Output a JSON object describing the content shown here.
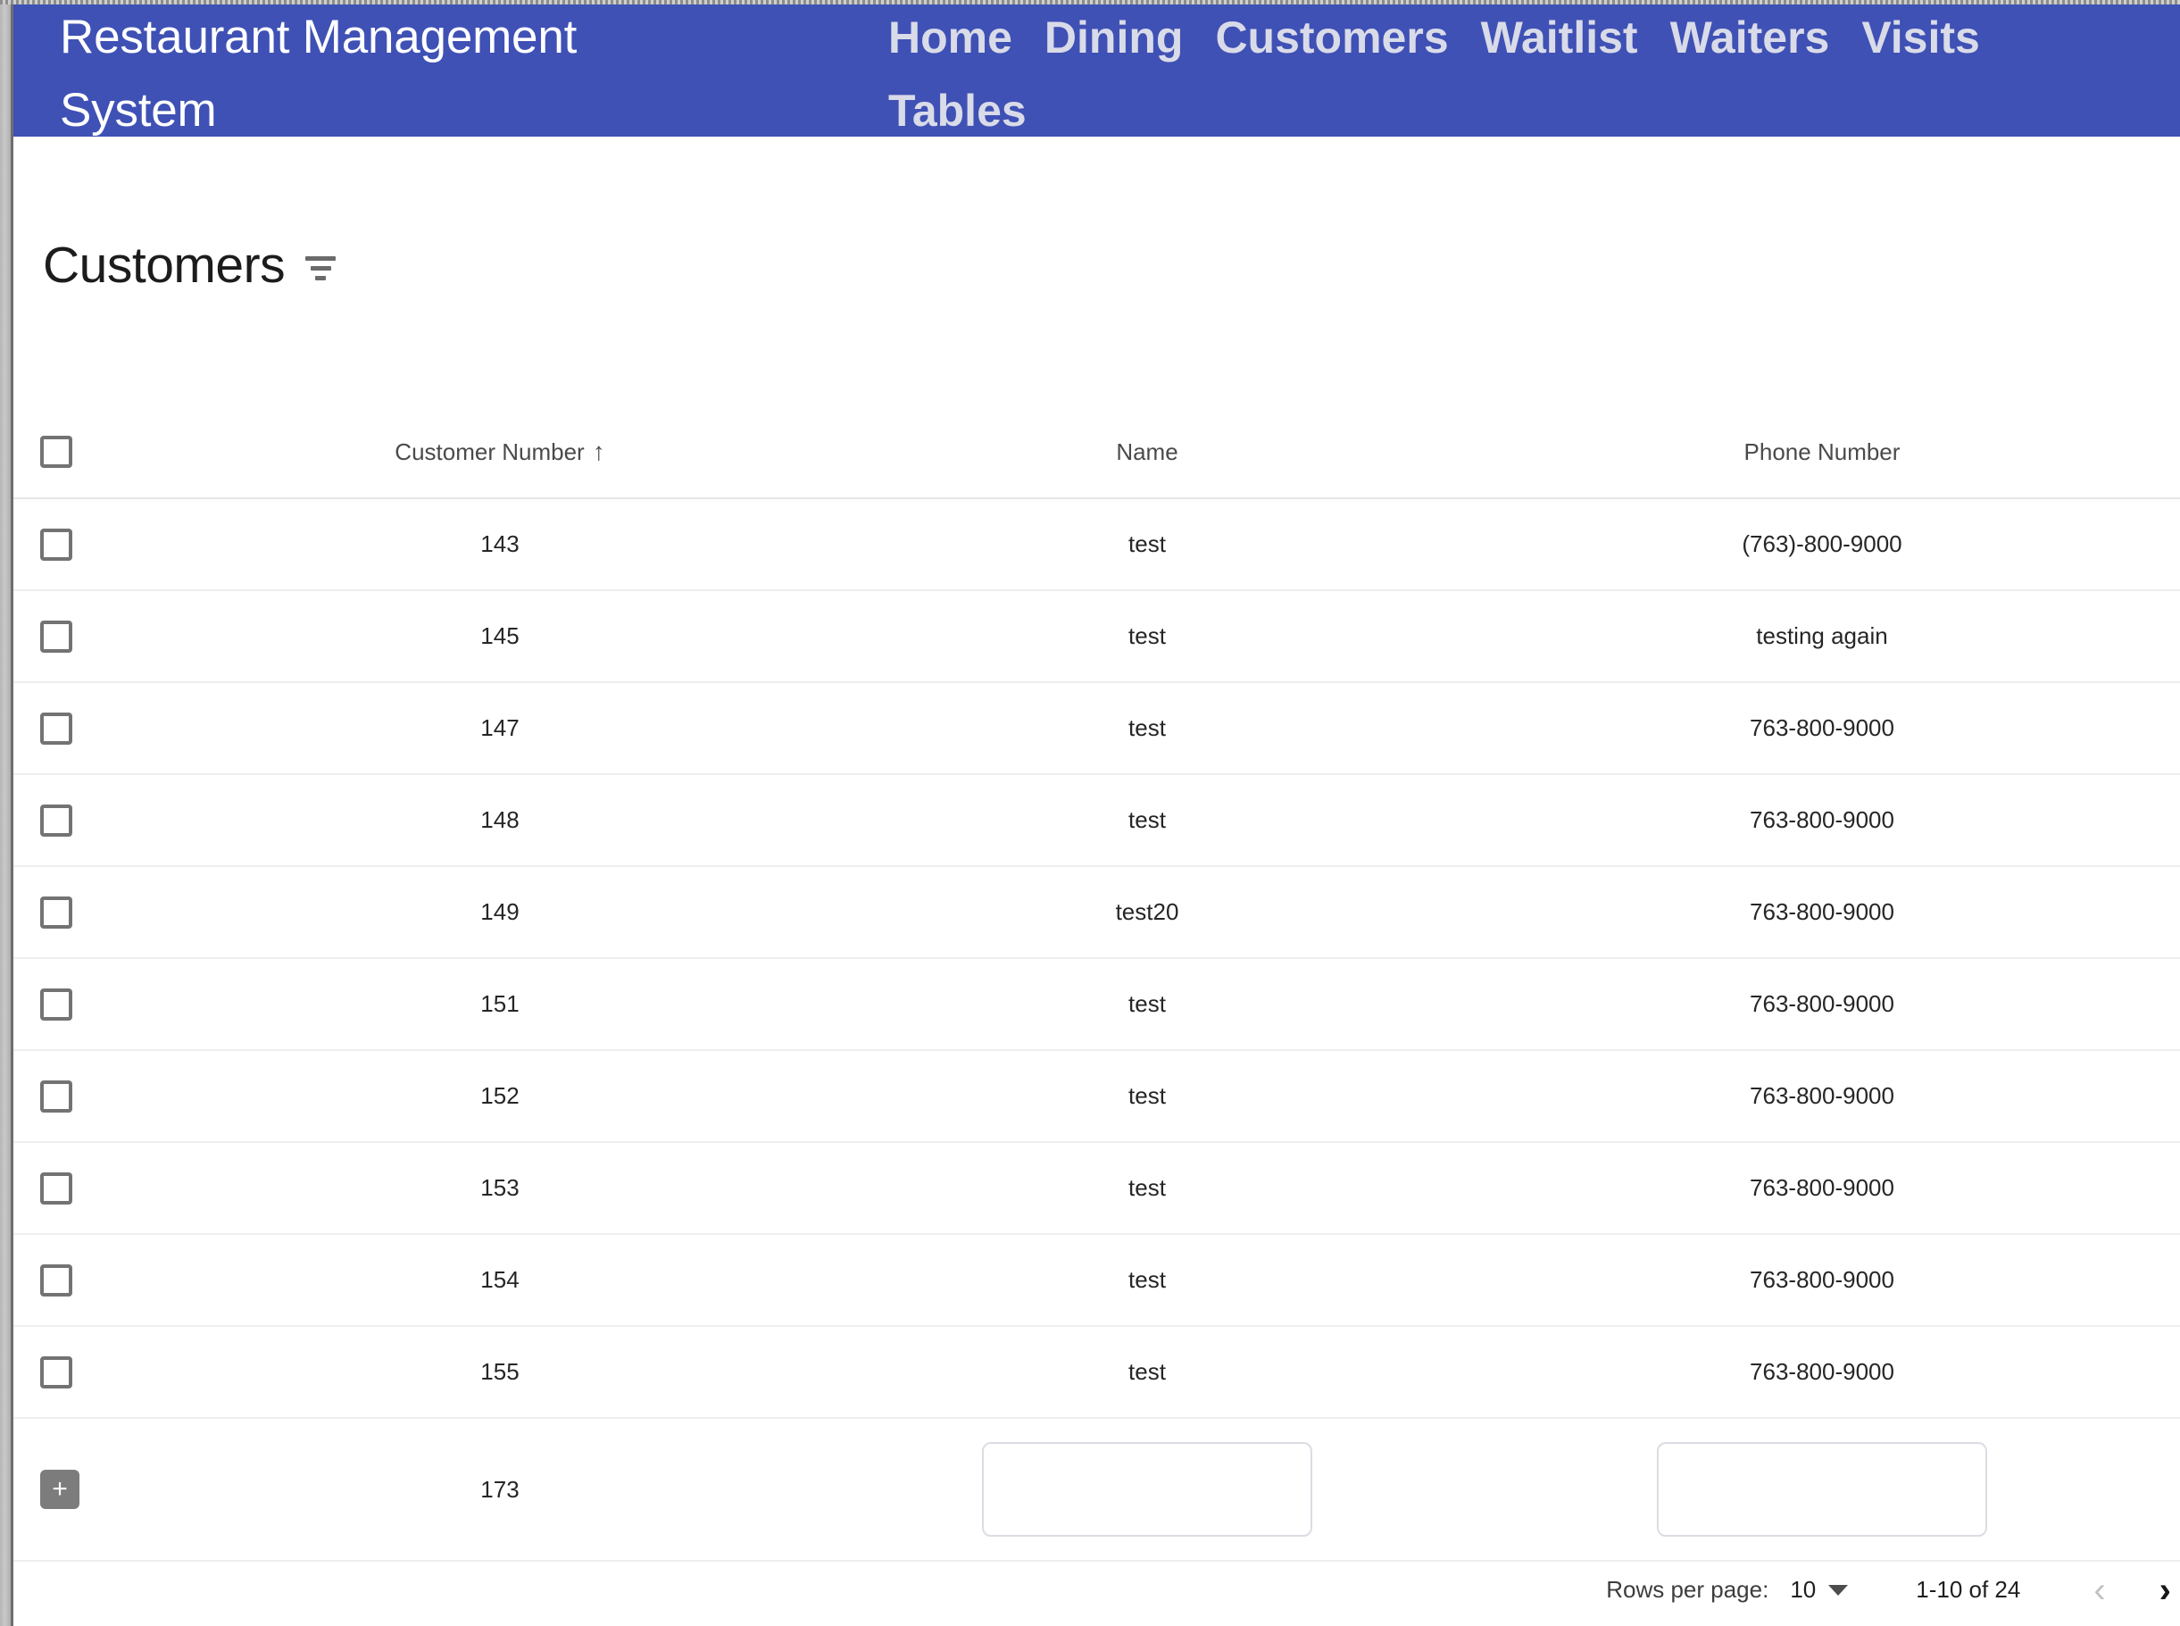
{
  "header": {
    "title": "Restaurant Management\nSystem",
    "nav": [
      {
        "label": "Home"
      },
      {
        "label": "Dining"
      },
      {
        "label": "Customers"
      },
      {
        "label": "Waitlist"
      },
      {
        "label": "Waiters"
      },
      {
        "label": "Visits"
      },
      {
        "label": "Tables"
      }
    ],
    "background_color": "#3f51b5",
    "title_color": "#ffffff",
    "nav_color": "#d9dbe8"
  },
  "page": {
    "title": "Customers",
    "filter_icon": "filter-list-icon"
  },
  "table": {
    "columns": [
      {
        "key": "select",
        "label": ""
      },
      {
        "key": "customer_number",
        "label": "Customer Number",
        "sort": "asc",
        "sort_glyph": "↑"
      },
      {
        "key": "name",
        "label": "Name"
      },
      {
        "key": "phone_number",
        "label": "Phone Number"
      }
    ],
    "rows": [
      {
        "customer_number": "143",
        "name": "test",
        "phone_number": "(763)-800-9000"
      },
      {
        "customer_number": "145",
        "name": "test",
        "phone_number": "testing again"
      },
      {
        "customer_number": "147",
        "name": "test",
        "phone_number": "763-800-9000"
      },
      {
        "customer_number": "148",
        "name": "test",
        "phone_number": "763-800-9000"
      },
      {
        "customer_number": "149",
        "name": "test20",
        "phone_number": "763-800-9000"
      },
      {
        "customer_number": "151",
        "name": "test",
        "phone_number": "763-800-9000"
      },
      {
        "customer_number": "152",
        "name": "test",
        "phone_number": "763-800-9000"
      },
      {
        "customer_number": "153",
        "name": "test",
        "phone_number": "763-800-9000"
      },
      {
        "customer_number": "154",
        "name": "test",
        "phone_number": "763-800-9000"
      },
      {
        "customer_number": "155",
        "name": "test",
        "phone_number": "763-800-9000"
      }
    ],
    "add_row": {
      "add_button_label": "+",
      "customer_number": "173",
      "name_value": "",
      "name_placeholder": "",
      "phone_value": "",
      "phone_placeholder": ""
    }
  },
  "paginator": {
    "rows_per_page_label": "Rows per page:",
    "rows_per_page_value": "10",
    "range_label": "1-10 of 24",
    "prev_glyph": "‹",
    "next_glyph": "›",
    "prev_enabled": "false",
    "next_enabled": "true"
  }
}
